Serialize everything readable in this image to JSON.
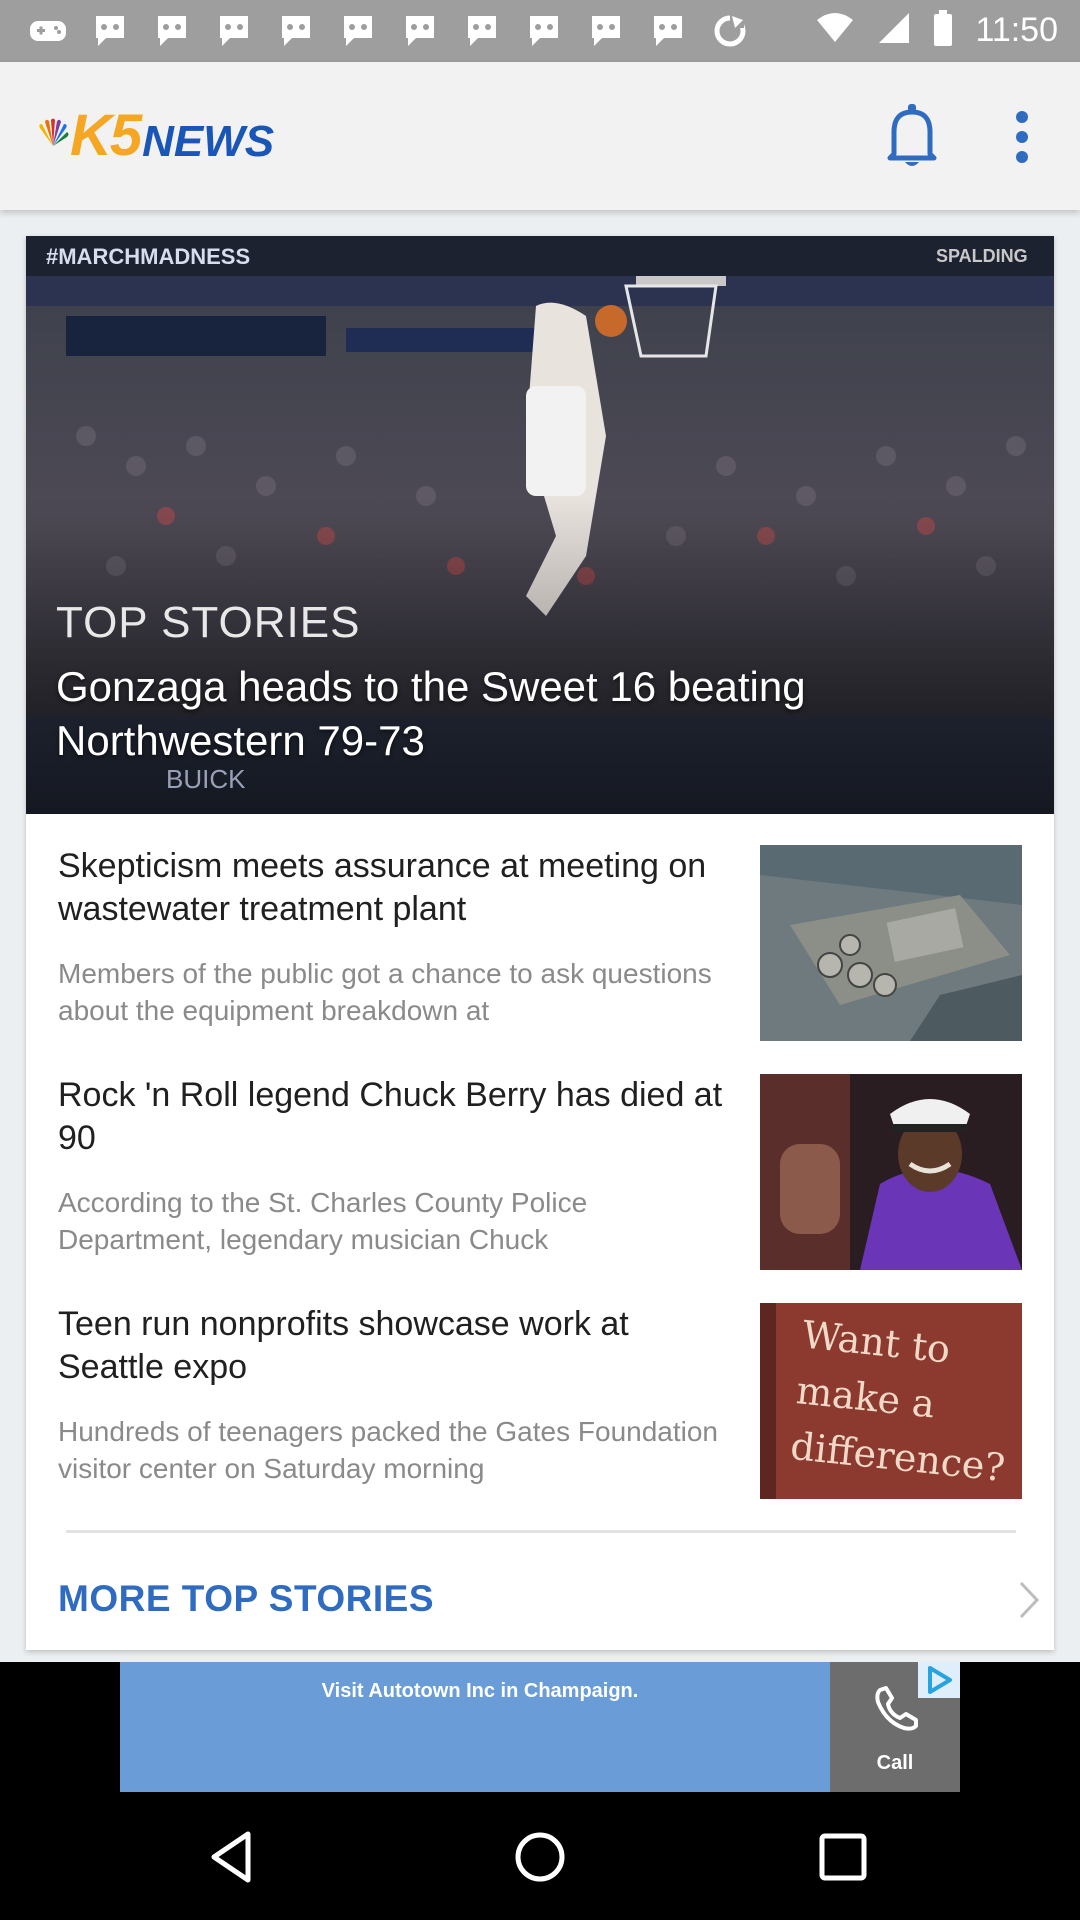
{
  "status_bar": {
    "time": "11:50",
    "notification_icons": [
      "game-icon",
      "chat-icon",
      "chat-icon",
      "chat-icon",
      "chat-icon",
      "chat-icon",
      "chat-icon",
      "chat-icon",
      "chat-icon",
      "chat-icon",
      "chat-icon",
      "sync-icon"
    ]
  },
  "app_bar": {
    "logo_k5": "K5",
    "logo_news": "NEWS"
  },
  "hero": {
    "section_label": "TOP STORIES",
    "title": "Gonzaga heads to the Sweet 16 beating Northwestern 79-73",
    "image_caption_texts": [
      "#MARCHMADNESS",
      "SPALDING",
      "BUICK"
    ]
  },
  "stories": [
    {
      "title": "Skepticism meets assurance at meeting on wastewater treatment plant",
      "summary": "Members of the public got a chance to ask questions about the equipment breakdown at"
    },
    {
      "title": "Rock 'n Roll legend Chuck Berry has died at 90",
      "summary": "According to the St. Charles County Police Department, legendary musician Chuck"
    },
    {
      "title": "Teen run nonprofits showcase work at Seattle expo",
      "summary": "Hundreds of teenagers packed the Gates Foundation visitor center on Saturday morning",
      "thumb_text": "Want to make a difference?"
    }
  ],
  "more_link": {
    "label": "MORE TOP STORIES"
  },
  "ad": {
    "text": "Visit Autotown Inc in Champaign.",
    "call_label": "Call"
  },
  "colors": {
    "status_bar": "#9e9e9e",
    "app_bar": "#f2f2f2",
    "link_blue": "#2f6cc1",
    "logo_orange": "#f5a623",
    "logo_blue": "#1a56b8",
    "ad_blue": "#6a9cd8"
  }
}
